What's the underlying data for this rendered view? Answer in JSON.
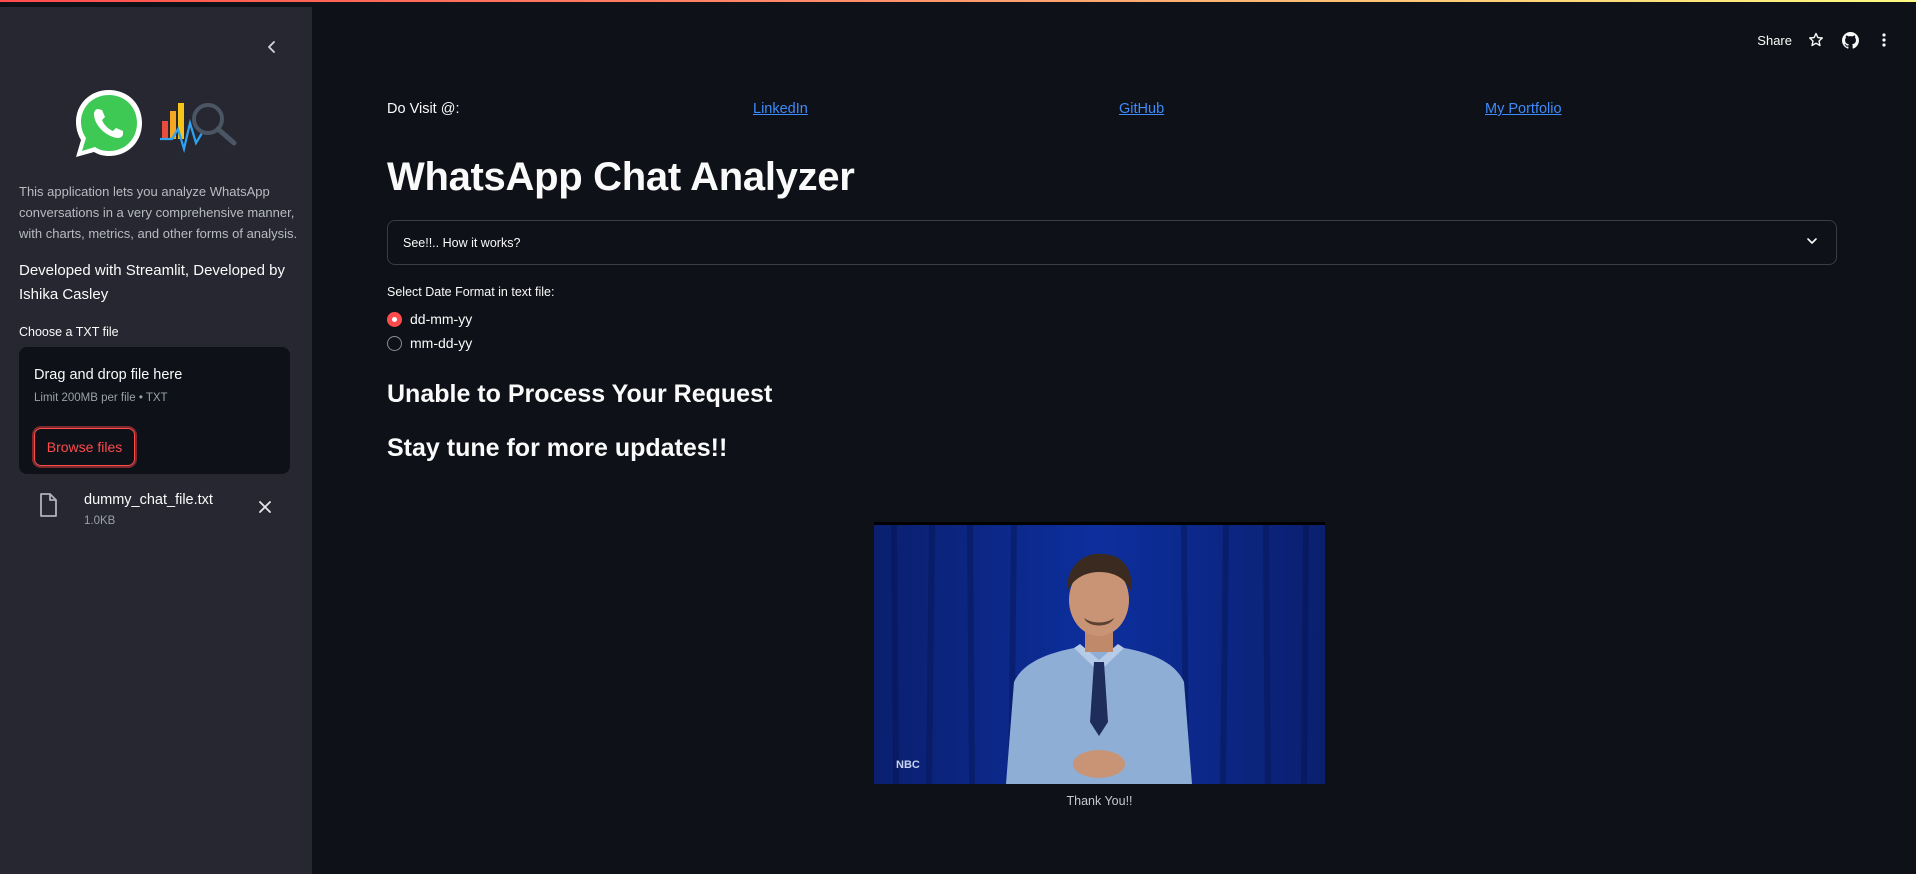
{
  "sidebar": {
    "description": "This application lets you analyze WhatsApp conversations in a very comprehensive manner, with charts, metrics, and other forms of analysis.",
    "developer": "Developed with Streamlit, Developed by Ishika Casley",
    "uploader": {
      "label": "Choose a TXT file",
      "dropzone_title": "Drag and drop file here",
      "limit": "Limit 200MB per file • TXT",
      "browse_label": "Browse files"
    },
    "file": {
      "name": "dummy_chat_file.txt",
      "size": "1.0KB"
    }
  },
  "header": {
    "share_label": "Share"
  },
  "main": {
    "visit_label": "Do Visit @:",
    "links": [
      {
        "label": "LinkedIn"
      },
      {
        "label": "GitHub"
      },
      {
        "label": "My Portfolio"
      }
    ],
    "title": "WhatsApp Chat Analyzer",
    "expander_label": "See!!.. How it works?",
    "date_format": {
      "label": "Select Date Format in text file:",
      "options": [
        "dd-mm-yy",
        "mm-dd-yy"
      ],
      "selected": "dd-mm-yy"
    },
    "error_heading": "Unable to Process Your Request",
    "updates_heading": "Stay tune for more updates!!",
    "image_watermark": "NBC",
    "image_caption": "Thank You!!"
  },
  "colors": {
    "accent": "#ff4b4b",
    "link": "#3d8bfd",
    "sidebar_bg": "#262730",
    "main_bg": "#0e1117"
  }
}
